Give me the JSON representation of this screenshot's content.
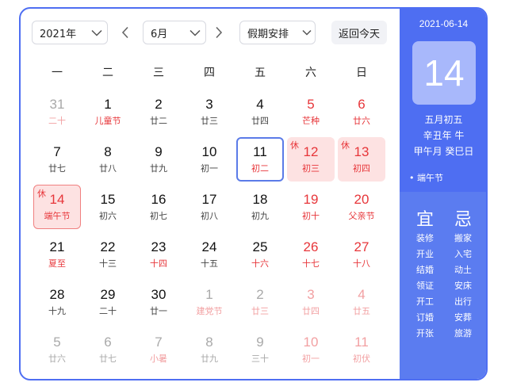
{
  "toolbar": {
    "year": "2021年",
    "month": "6月",
    "holiday": "假期安排",
    "today_button": "返回今天"
  },
  "weekdays": [
    "一",
    "二",
    "三",
    "四",
    "五",
    "六",
    "日"
  ],
  "days": [
    {
      "num": "31",
      "sub": "二十",
      "faded": true,
      "subred": true
    },
    {
      "num": "1",
      "sub": "儿童节",
      "subred": true
    },
    {
      "num": "2",
      "sub": "廿二"
    },
    {
      "num": "3",
      "sub": "廿三"
    },
    {
      "num": "4",
      "sub": "廿四"
    },
    {
      "num": "5",
      "sub": "芒种",
      "red": true
    },
    {
      "num": "6",
      "sub": "廿六",
      "red": true
    },
    {
      "num": "7",
      "sub": "廿七"
    },
    {
      "num": "8",
      "sub": "廿八"
    },
    {
      "num": "9",
      "sub": "廿九"
    },
    {
      "num": "10",
      "sub": "初一"
    },
    {
      "num": "11",
      "sub": "初二",
      "subred": true,
      "selected": true
    },
    {
      "num": "12",
      "sub": "初三",
      "red": true,
      "holiday": true,
      "badge": "休"
    },
    {
      "num": "13",
      "sub": "初四",
      "red": true,
      "holiday": true,
      "badge": "休"
    },
    {
      "num": "14",
      "sub": "端午节",
      "red": true,
      "today": true,
      "badge": "休"
    },
    {
      "num": "15",
      "sub": "初六"
    },
    {
      "num": "16",
      "sub": "初七"
    },
    {
      "num": "17",
      "sub": "初八"
    },
    {
      "num": "18",
      "sub": "初九"
    },
    {
      "num": "19",
      "sub": "初十",
      "red": true
    },
    {
      "num": "20",
      "sub": "父亲节",
      "red": true
    },
    {
      "num": "21",
      "sub": "夏至",
      "subred": true
    },
    {
      "num": "22",
      "sub": "十三"
    },
    {
      "num": "23",
      "sub": "十四",
      "subred": true
    },
    {
      "num": "24",
      "sub": "十五"
    },
    {
      "num": "25",
      "sub": "十六",
      "subred": true
    },
    {
      "num": "26",
      "sub": "十七",
      "red": true
    },
    {
      "num": "27",
      "sub": "十八",
      "red": true
    },
    {
      "num": "28",
      "sub": "十九"
    },
    {
      "num": "29",
      "sub": "二十"
    },
    {
      "num": "30",
      "sub": "廿一"
    },
    {
      "num": "1",
      "sub": "建党节",
      "faded": true,
      "subred": true
    },
    {
      "num": "2",
      "sub": "廿三",
      "faded": true,
      "subred": true
    },
    {
      "num": "3",
      "sub": "廿四",
      "faded": true,
      "red": true
    },
    {
      "num": "4",
      "sub": "廿五",
      "faded": true,
      "red": true
    },
    {
      "num": "5",
      "sub": "廿六",
      "faded": true
    },
    {
      "num": "6",
      "sub": "廿七",
      "faded": true
    },
    {
      "num": "7",
      "sub": "小暑",
      "faded": true,
      "subred": true
    },
    {
      "num": "8",
      "sub": "廿九",
      "faded": true
    },
    {
      "num": "9",
      "sub": "三十",
      "faded": true
    },
    {
      "num": "10",
      "sub": "初一",
      "faded": true,
      "red": true
    },
    {
      "num": "11",
      "sub": "初伏",
      "faded": true,
      "red": true
    }
  ],
  "side": {
    "date": "2021-06-14",
    "day": "14",
    "lunar": "五月初五",
    "year_gz": "辛丑年 牛",
    "month_day_gz": "甲午月 癸巳日",
    "festival": "• 端午节",
    "yi_title": "宜",
    "ji_title": "忌",
    "yi": [
      "装修",
      "开业",
      "结婚",
      "领证",
      "开工",
      "订婚",
      "开张"
    ],
    "ji": [
      "搬家",
      "入宅",
      "动土",
      "安床",
      "出行",
      "安葬",
      "旅游"
    ]
  },
  "colors": {
    "accent": "#4e6ef2",
    "holiday_red": "#e7363a",
    "holiday_bg": "#fde2e2"
  }
}
